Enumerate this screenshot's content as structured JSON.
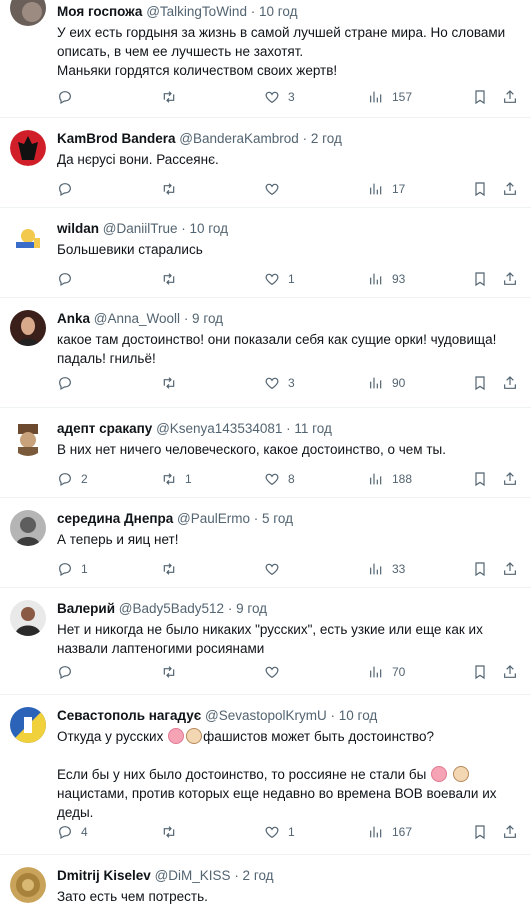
{
  "tweets": [
    {
      "name": "Моя госпожа",
      "handle": "@TalkingToWind",
      "time": "· 10 год",
      "lines": [
        "У еих есть гордыня за жизнь в самой лучшей стране мира. Но словами",
        "описать, в чем ее лучшесть не захотят.",
        "Маньяки гордятся количеством своих жертв!"
      ],
      "replies": "",
      "retweets": "",
      "likes": "3",
      "views": "157"
    },
    {
      "name": "KamBrod Bandera",
      "handle": "@BanderaKambrod",
      "time": "· 2 год",
      "lines": [
        "Да нєрусі вони. Рассеянє."
      ],
      "replies": "",
      "retweets": "",
      "likes": "",
      "views": "17"
    },
    {
      "name": "wildan",
      "handle": "@DaniilTrue",
      "time": "· 10 год",
      "lines": [
        "Большевики старались"
      ],
      "replies": "",
      "retweets": "",
      "likes": "1",
      "views": "93"
    },
    {
      "name": "Anka",
      "handle": "@Anna_Wooll",
      "time": "· 9 год",
      "lines": [
        "какое там достоинство! они показали себя как сущие орки! чудовища!",
        "падаль! гнильё!"
      ],
      "replies": "",
      "retweets": "",
      "likes": "3",
      "views": "90"
    },
    {
      "name": "адепт сракапу",
      "handle": "@Ksenya143534081",
      "time": "· 11 год",
      "lines": [
        "В них нет ничего человеческого, какое достоинство, о чем ты."
      ],
      "replies": "2",
      "retweets": "1",
      "likes": "8",
      "views": "188"
    },
    {
      "name": "середина Днепра",
      "handle": "@PaulErmo",
      "time": "· 5 год",
      "lines": [
        "А теперь и яиц нет!"
      ],
      "replies": "1",
      "retweets": "",
      "likes": "",
      "views": "33"
    },
    {
      "name": "Валерий",
      "handle": "@Bady5Bady512",
      "time": "· 9 год",
      "lines": [
        "Нет и никогда не было никаких \"русских\", есть узкие или еще как их",
        "назвали лаптеногими росиянами"
      ],
      "replies": "",
      "retweets": "",
      "likes": "",
      "views": "70"
    },
    {
      "name": "Севастополь нагадує",
      "handle": "@SevastopolKrymU",
      "time": "· 10 год",
      "line1_a": "Откуда у русских",
      "line1_b": "фашистов может быть достоинство?",
      "line2_a": "Если бы у них было достоинство, то россияне не стали бы",
      "line3": "нацистами, против которых еще недавно во времена ВОВ воевали их",
      "line4": "деды.",
      "replies": "4",
      "retweets": "",
      "likes": "1",
      "views": "167"
    },
    {
      "name": "Dmitrij Kiselev",
      "handle": "@DiM_KISS",
      "time": "· 2 год",
      "lines": [
        "Зато есть чем потресть."
      ]
    }
  ]
}
